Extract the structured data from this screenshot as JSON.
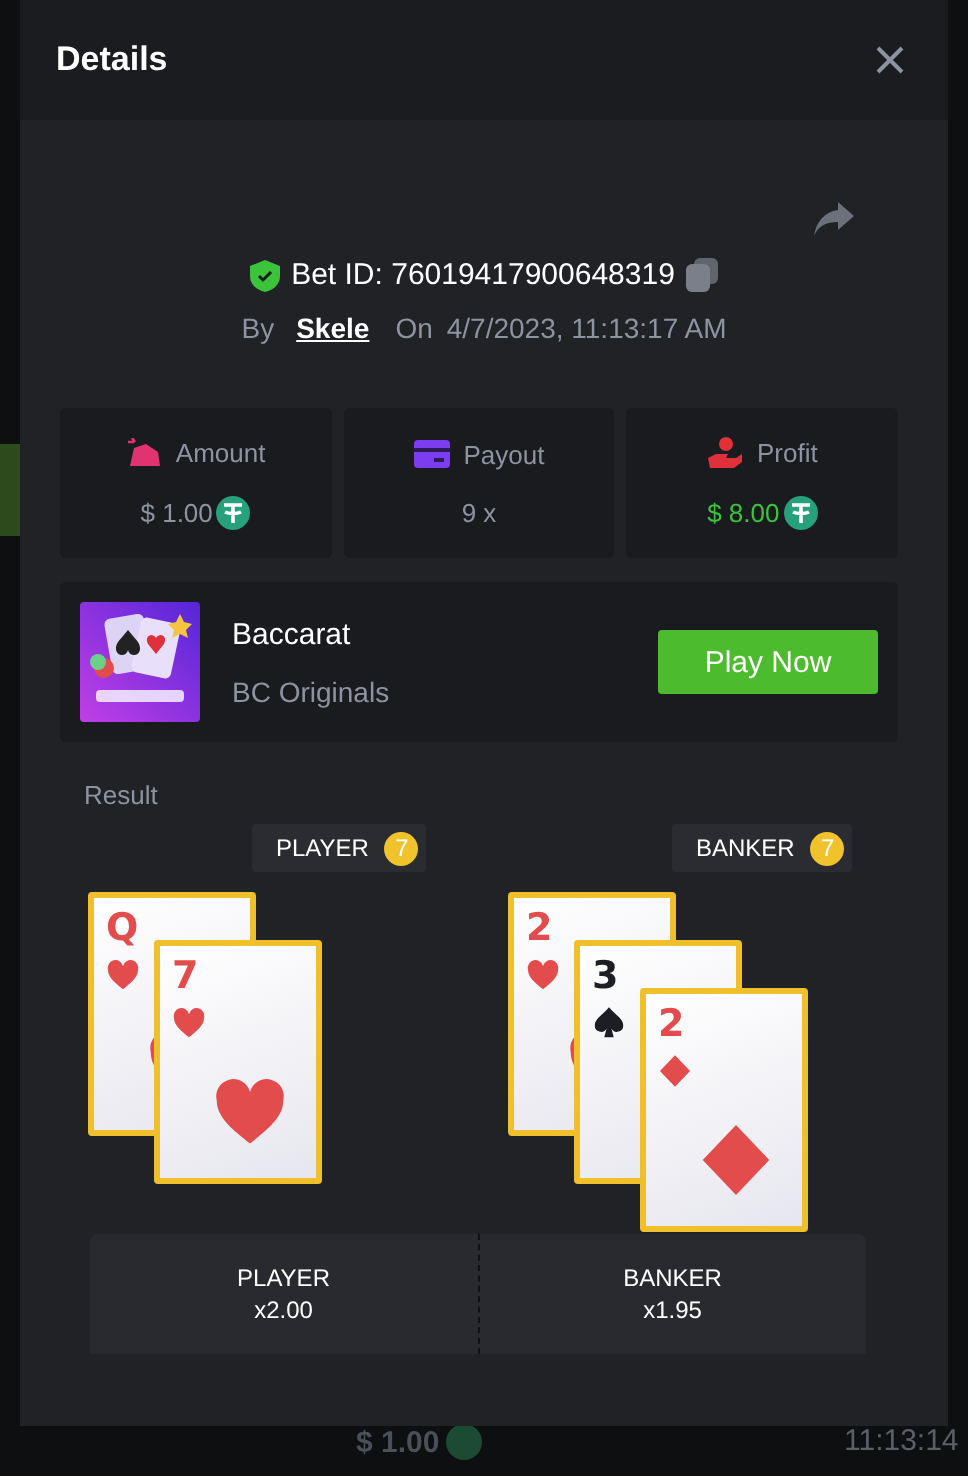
{
  "backdrop": {
    "bottom_amount": "$ 1.00",
    "bottom_time": "11:13:14"
  },
  "dialog": {
    "title": "Details"
  },
  "bet": {
    "id_text": "Bet ID: 76019417900648319",
    "verified": true,
    "by_label": "By",
    "user": "Skele",
    "on_label": "On",
    "date": "4/7/2023, 11:13:17 AM"
  },
  "stats": [
    {
      "kind": "amount",
      "label": "Amount",
      "value": "$ 1.00",
      "coin": true
    },
    {
      "kind": "payout",
      "label": "Payout",
      "value": "9 x",
      "coin": false
    },
    {
      "kind": "profit",
      "label": "Profit",
      "value": "$ 8.00",
      "coin": true
    }
  ],
  "game": {
    "name": "Baccarat",
    "provider": "BC Originals",
    "button": "Play Now"
  },
  "result": {
    "label": "Result",
    "hands": [
      {
        "name": "PLAYER",
        "score": "7",
        "cards": [
          {
            "rank": "Q",
            "kind": "hearts"
          },
          {
            "rank": "7",
            "kind": "hearts"
          }
        ]
      },
      {
        "name": "BANKER",
        "score": "7",
        "cards": [
          {
            "rank": "2",
            "kind": "hearts"
          },
          {
            "rank": "3",
            "kind": "spades"
          },
          {
            "rank": "2",
            "kind": "diamonds"
          }
        ]
      }
    ]
  },
  "bets": [
    {
      "name": "PLAYER",
      "odds": "x2.00"
    },
    {
      "name": "BANKER",
      "odds": "x1.95"
    }
  ]
}
